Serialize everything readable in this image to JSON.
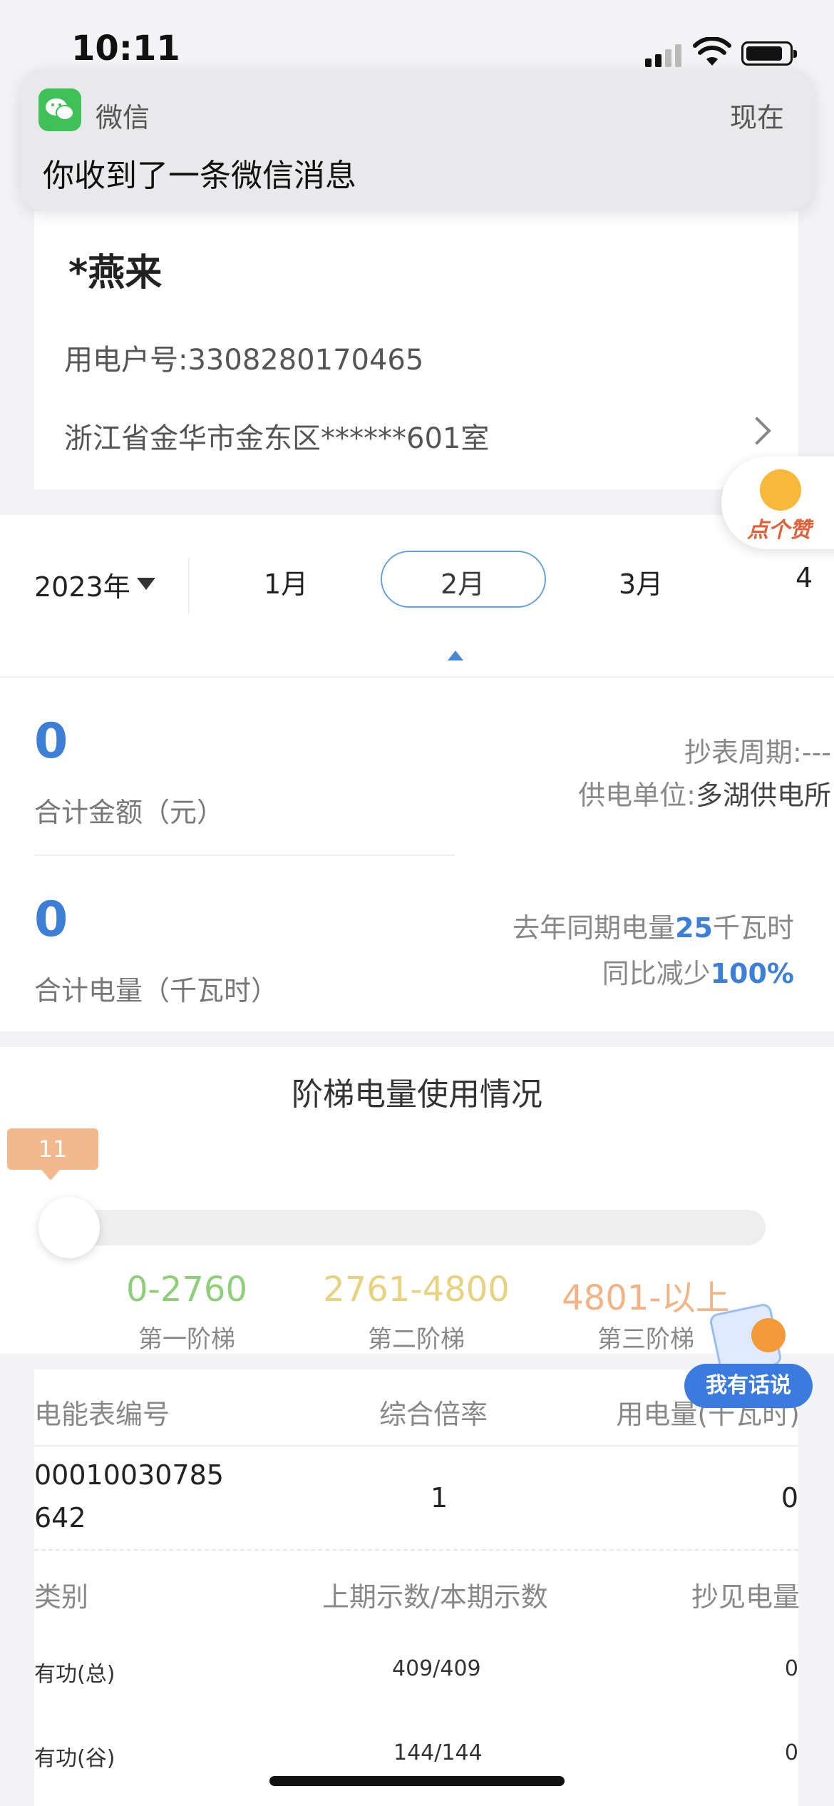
{
  "status_bar": {
    "time": "10:11"
  },
  "notification": {
    "app": "微信",
    "time": "现在",
    "message": "你收到了一条微信消息"
  },
  "account_card": {
    "name": "*燕来",
    "account_number": "用电户号:3308280170465",
    "address": "浙江省金华市金东区******601室"
  },
  "like_button": {
    "label": "点个赞"
  },
  "month_selector": {
    "year": "2023年",
    "months": [
      "1月",
      "2月",
      "3月",
      "4"
    ],
    "selected": "2月"
  },
  "summary": {
    "amount_value": "0",
    "amount_label": "合计金额（元）",
    "energy_value": "0",
    "energy_label": "合计电量（千瓦时）",
    "reading_period_label": "抄表周期:",
    "reading_period_value": "---",
    "supplier_label": "供电单位:",
    "supplier_value": "多湖供电所",
    "last_year_prefix": "去年同期电量",
    "last_year_value": "25",
    "last_year_unit": "千瓦时",
    "yoy_prefix": "同比减少",
    "yoy_value": "100%"
  },
  "tier_usage": {
    "title": "阶梯电量使用情况",
    "current_badge": "11",
    "current_fill_fraction": 0.004,
    "tiers": [
      {
        "range": "0-2760",
        "name": "第一阶梯",
        "color": "#8fcf7a"
      },
      {
        "range": "2761-4800",
        "name": "第二阶梯",
        "color": "#e6d27f"
      },
      {
        "range": "4801-以上",
        "name": "第三阶梯",
        "color": "#f0b487"
      }
    ]
  },
  "feedback_button": {
    "label": "我有话说"
  },
  "meter_table": {
    "headers": [
      "电能表编号",
      "综合倍率",
      "用电量(千瓦时)"
    ],
    "meter_number_line1": "00010030785",
    "meter_number_line2": "642",
    "multiplier": "1",
    "usage": "0",
    "reading_headers": [
      "类别",
      "上期示数/本期示数",
      "抄见电量"
    ],
    "readings": [
      {
        "type": "有功(总)",
        "value": "409/409",
        "energy": "0"
      },
      {
        "type": "有功(谷)",
        "value": "144/144",
        "energy": "0"
      }
    ]
  },
  "colors": {
    "accent_blue": "#3d7fd6",
    "badge_orange": "#f2b98f",
    "wechat_green": "#3fc158"
  }
}
